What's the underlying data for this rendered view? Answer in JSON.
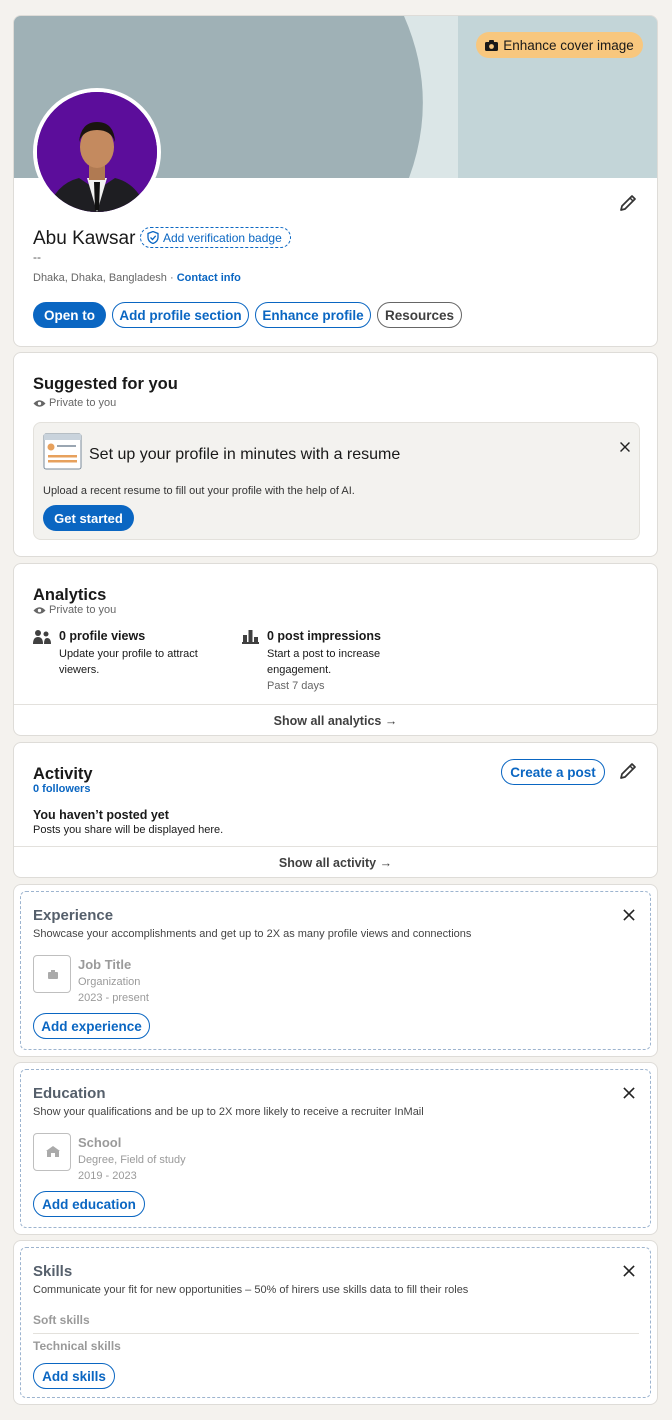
{
  "profile": {
    "enhance_cover_label": "Enhance cover image",
    "name": "Abu Kawsar",
    "verification_label": "Add verification badge",
    "headline": "--",
    "location": "Dhaka, Dhaka, Bangladesh",
    "separator": "·",
    "contact_info": "Contact info",
    "actions": [
      "Open to",
      "Add profile section",
      "Enhance profile",
      "Resources"
    ]
  },
  "suggested": {
    "title": "Suggested for you",
    "privacy": "Private to you",
    "card_title": "Set up your profile in minutes with a resume",
    "card_text": "Upload a recent resume to fill out your profile with the help of AI.",
    "cta": "Get started"
  },
  "analytics": {
    "title": "Analytics",
    "privacy": "Private to you",
    "profile_views": "0 profile views",
    "profile_views_desc_1": "Update your profile to attract",
    "profile_views_desc_2": "viewers.",
    "post_impressions": "0 post impressions",
    "post_impressions_desc_1": "Start a post to increase",
    "post_impressions_desc_2": "engagement.",
    "period": "Past 7 days",
    "show_all": "Show all analytics →"
  },
  "activity": {
    "title": "Activity",
    "followers": "0 followers",
    "create_post": "Create a post",
    "empty_title": "You haven’t posted yet",
    "empty_text": "Posts you share will be displayed here.",
    "show_all": "Show all activity →"
  },
  "experience": {
    "title": "Experience",
    "description": "Showcase your accomplishments and get up to 2X as many profile views and connections",
    "placeholder_title": "Job Title",
    "placeholder_org": "Organization",
    "placeholder_dates": "2023 - present",
    "add_label": "Add experience"
  },
  "education": {
    "title": "Education",
    "description": "Show your qualifications and be up to 2X more likely to receive a recruiter InMail",
    "placeholder_title": "School",
    "placeholder_degree": "Degree, Field of study",
    "placeholder_dates": "2019 - 2023",
    "add_label": "Add education"
  },
  "skills": {
    "title": "Skills",
    "description": "Communicate your fit for new opportunities – 50% of hirers use skills data to fill their roles",
    "soft": "Soft skills",
    "technical": "Technical skills",
    "add_label": "Add skills"
  },
  "colors": {
    "brand": "#0a66c2",
    "cover_left": "#9fb1b6",
    "cover_right": "#c3d5d8",
    "enhance_pill": "#f8c77e",
    "avatar_bg": "#5c0d9b"
  }
}
